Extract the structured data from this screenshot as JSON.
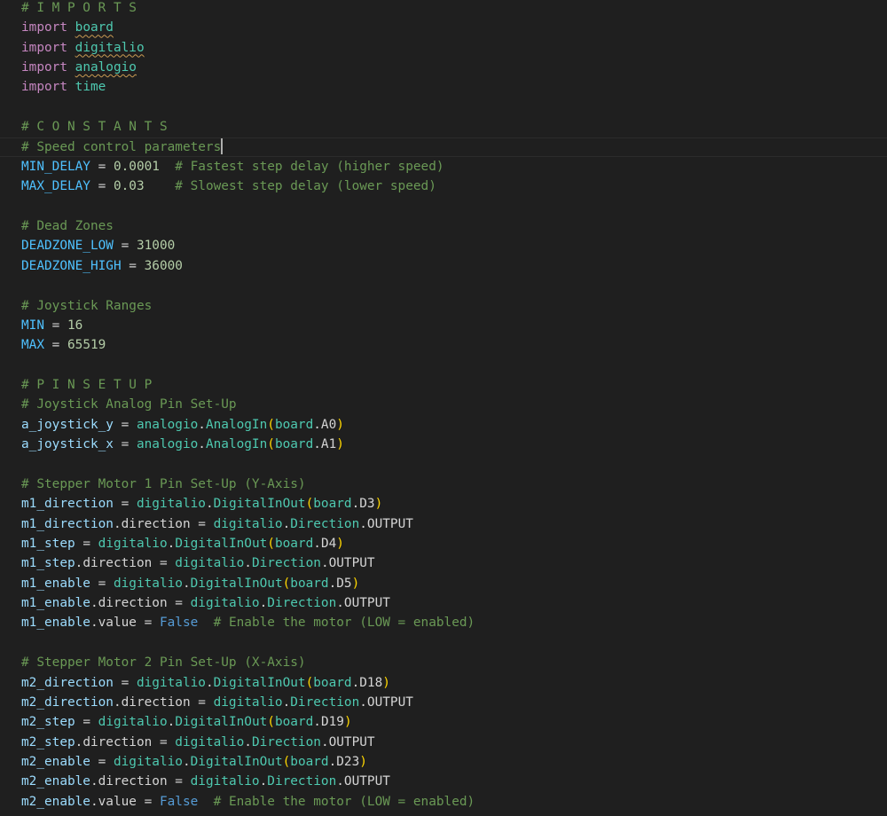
{
  "editor": {
    "background": "#1f1f1f",
    "colors": {
      "keyword": "#c586c0",
      "module": "#4ec9b0",
      "variable": "#9cdcfe",
      "constant": "#4fc1ff",
      "number": "#b5cea8",
      "comment": "#6a9955",
      "text": "#d4d4d4",
      "bool": "#569cd6",
      "paren": "#ffd700",
      "paren2": "#da70d6",
      "cls": "#4ec9b0"
    },
    "lines": [
      [
        {
          "t": "# I M P O R T S",
          "c": "comment"
        }
      ],
      [
        {
          "t": "import",
          "c": "keyword"
        },
        {
          "t": " "
        },
        {
          "t": "board",
          "c": "module",
          "s": 1
        }
      ],
      [
        {
          "t": "import",
          "c": "keyword"
        },
        {
          "t": " "
        },
        {
          "t": "digitalio",
          "c": "module",
          "s": 1
        }
      ],
      [
        {
          "t": "import",
          "c": "keyword"
        },
        {
          "t": " "
        },
        {
          "t": "analogio",
          "c": "module",
          "s": 1
        }
      ],
      [
        {
          "t": "import",
          "c": "keyword"
        },
        {
          "t": " "
        },
        {
          "t": "time",
          "c": "module"
        }
      ],
      [],
      [
        {
          "t": "# C O N S T A N T S",
          "c": "comment"
        }
      ],
      [
        {
          "t": "# Speed control parameters",
          "c": "comment"
        },
        {
          "cursor": true
        }
      ],
      [
        {
          "t": "MIN_DELAY",
          "c": "constant"
        },
        {
          "t": " = "
        },
        {
          "t": "0.0001",
          "c": "number"
        },
        {
          "t": "  "
        },
        {
          "t": "# Fastest step delay (higher speed)",
          "c": "comment"
        }
      ],
      [
        {
          "t": "MAX_DELAY",
          "c": "constant"
        },
        {
          "t": " = "
        },
        {
          "t": "0.03",
          "c": "number"
        },
        {
          "t": "    "
        },
        {
          "t": "# Slowest step delay (lower speed)",
          "c": "comment"
        }
      ],
      [],
      [
        {
          "t": "# Dead Zones",
          "c": "comment"
        }
      ],
      [
        {
          "t": "DEADZONE_LOW",
          "c": "constant"
        },
        {
          "t": " = "
        },
        {
          "t": "31000",
          "c": "number"
        }
      ],
      [
        {
          "t": "DEADZONE_HIGH",
          "c": "constant"
        },
        {
          "t": " = "
        },
        {
          "t": "36000",
          "c": "number"
        }
      ],
      [],
      [
        {
          "t": "# Joystick Ranges",
          "c": "comment"
        }
      ],
      [
        {
          "t": "MIN",
          "c": "constant"
        },
        {
          "t": " = "
        },
        {
          "t": "16",
          "c": "number"
        }
      ],
      [
        {
          "t": "MAX",
          "c": "constant"
        },
        {
          "t": " = "
        },
        {
          "t": "65519",
          "c": "number"
        }
      ],
      [],
      [
        {
          "t": "# P I N S E T U P",
          "c": "comment"
        }
      ],
      [
        {
          "t": "# Joystick Analog Pin Set-Up",
          "c": "comment"
        }
      ],
      [
        {
          "t": "a_joystick_y",
          "c": "variable"
        },
        {
          "t": " = "
        },
        {
          "t": "analogio",
          "c": "module"
        },
        {
          "t": "."
        },
        {
          "t": "AnalogIn",
          "c": "cls"
        },
        {
          "t": "(",
          "c": "paren"
        },
        {
          "t": "board",
          "c": "module"
        },
        {
          "t": ".A0"
        },
        {
          "t": ")",
          "c": "paren"
        }
      ],
      [
        {
          "t": "a_joystick_x",
          "c": "variable"
        },
        {
          "t": " = "
        },
        {
          "t": "analogio",
          "c": "module"
        },
        {
          "t": "."
        },
        {
          "t": "AnalogIn",
          "c": "cls"
        },
        {
          "t": "(",
          "c": "paren"
        },
        {
          "t": "board",
          "c": "module"
        },
        {
          "t": ".A1"
        },
        {
          "t": ")",
          "c": "paren"
        }
      ],
      [],
      [
        {
          "t": "# Stepper Motor 1 Pin Set-Up (Y-Axis)",
          "c": "comment"
        }
      ],
      [
        {
          "t": "m1_direction",
          "c": "variable"
        },
        {
          "t": " = "
        },
        {
          "t": "digitalio",
          "c": "module"
        },
        {
          "t": "."
        },
        {
          "t": "DigitalInOut",
          "c": "cls"
        },
        {
          "t": "(",
          "c": "paren"
        },
        {
          "t": "board",
          "c": "module"
        },
        {
          "t": ".D3"
        },
        {
          "t": ")",
          "c": "paren"
        }
      ],
      [
        {
          "t": "m1_direction",
          "c": "variable"
        },
        {
          "t": ".direction = "
        },
        {
          "t": "digitalio",
          "c": "module"
        },
        {
          "t": "."
        },
        {
          "t": "Direction",
          "c": "cls"
        },
        {
          "t": ".OUTPUT"
        }
      ],
      [
        {
          "t": "m1_step",
          "c": "variable"
        },
        {
          "t": " = "
        },
        {
          "t": "digitalio",
          "c": "module"
        },
        {
          "t": "."
        },
        {
          "t": "DigitalInOut",
          "c": "cls"
        },
        {
          "t": "(",
          "c": "paren"
        },
        {
          "t": "board",
          "c": "module"
        },
        {
          "t": ".D4"
        },
        {
          "t": ")",
          "c": "paren"
        }
      ],
      [
        {
          "t": "m1_step",
          "c": "variable"
        },
        {
          "t": ".direction = "
        },
        {
          "t": "digitalio",
          "c": "module"
        },
        {
          "t": "."
        },
        {
          "t": "Direction",
          "c": "cls"
        },
        {
          "t": ".OUTPUT"
        }
      ],
      [
        {
          "t": "m1_enable",
          "c": "variable"
        },
        {
          "t": " = "
        },
        {
          "t": "digitalio",
          "c": "module"
        },
        {
          "t": "."
        },
        {
          "t": "DigitalInOut",
          "c": "cls"
        },
        {
          "t": "(",
          "c": "paren"
        },
        {
          "t": "board",
          "c": "module"
        },
        {
          "t": ".D5"
        },
        {
          "t": ")",
          "c": "paren"
        }
      ],
      [
        {
          "t": "m1_enable",
          "c": "variable"
        },
        {
          "t": ".direction = "
        },
        {
          "t": "digitalio",
          "c": "module"
        },
        {
          "t": "."
        },
        {
          "t": "Direction",
          "c": "cls"
        },
        {
          "t": ".OUTPUT"
        }
      ],
      [
        {
          "t": "m1_enable",
          "c": "variable"
        },
        {
          "t": ".value = "
        },
        {
          "t": "False",
          "c": "bool"
        },
        {
          "t": "  "
        },
        {
          "t": "# Enable the motor (LOW = enabled)",
          "c": "comment"
        }
      ],
      [],
      [
        {
          "t": "# Stepper Motor 2 Pin Set-Up (X-Axis)",
          "c": "comment"
        }
      ],
      [
        {
          "t": "m2_direction",
          "c": "variable"
        },
        {
          "t": " = "
        },
        {
          "t": "digitalio",
          "c": "module"
        },
        {
          "t": "."
        },
        {
          "t": "DigitalInOut",
          "c": "cls"
        },
        {
          "t": "(",
          "c": "paren"
        },
        {
          "t": "board",
          "c": "module"
        },
        {
          "t": ".D18"
        },
        {
          "t": ")",
          "c": "paren"
        }
      ],
      [
        {
          "t": "m2_direction",
          "c": "variable"
        },
        {
          "t": ".direction = "
        },
        {
          "t": "digitalio",
          "c": "module"
        },
        {
          "t": "."
        },
        {
          "t": "Direction",
          "c": "cls"
        },
        {
          "t": ".OUTPUT"
        }
      ],
      [
        {
          "t": "m2_step",
          "c": "variable"
        },
        {
          "t": " = "
        },
        {
          "t": "digitalio",
          "c": "module"
        },
        {
          "t": "."
        },
        {
          "t": "DigitalInOut",
          "c": "cls"
        },
        {
          "t": "(",
          "c": "paren"
        },
        {
          "t": "board",
          "c": "module"
        },
        {
          "t": ".D19"
        },
        {
          "t": ")",
          "c": "paren"
        }
      ],
      [
        {
          "t": "m2_step",
          "c": "variable"
        },
        {
          "t": ".direction = "
        },
        {
          "t": "digitalio",
          "c": "module"
        },
        {
          "t": "."
        },
        {
          "t": "Direction",
          "c": "cls"
        },
        {
          "t": ".OUTPUT"
        }
      ],
      [
        {
          "t": "m2_enable",
          "c": "variable"
        },
        {
          "t": " = "
        },
        {
          "t": "digitalio",
          "c": "module"
        },
        {
          "t": "."
        },
        {
          "t": "DigitalInOut",
          "c": "cls"
        },
        {
          "t": "(",
          "c": "paren"
        },
        {
          "t": "board",
          "c": "module"
        },
        {
          "t": ".D23"
        },
        {
          "t": ")",
          "c": "paren"
        }
      ],
      [
        {
          "t": "m2_enable",
          "c": "variable"
        },
        {
          "t": ".direction = "
        },
        {
          "t": "digitalio",
          "c": "module"
        },
        {
          "t": "."
        },
        {
          "t": "Direction",
          "c": "cls"
        },
        {
          "t": ".OUTPUT"
        }
      ],
      [
        {
          "t": "m2_enable",
          "c": "variable"
        },
        {
          "t": ".value = "
        },
        {
          "t": "False",
          "c": "bool"
        },
        {
          "t": "  "
        },
        {
          "t": "# Enable the motor (LOW = enabled)",
          "c": "comment"
        }
      ]
    ]
  }
}
